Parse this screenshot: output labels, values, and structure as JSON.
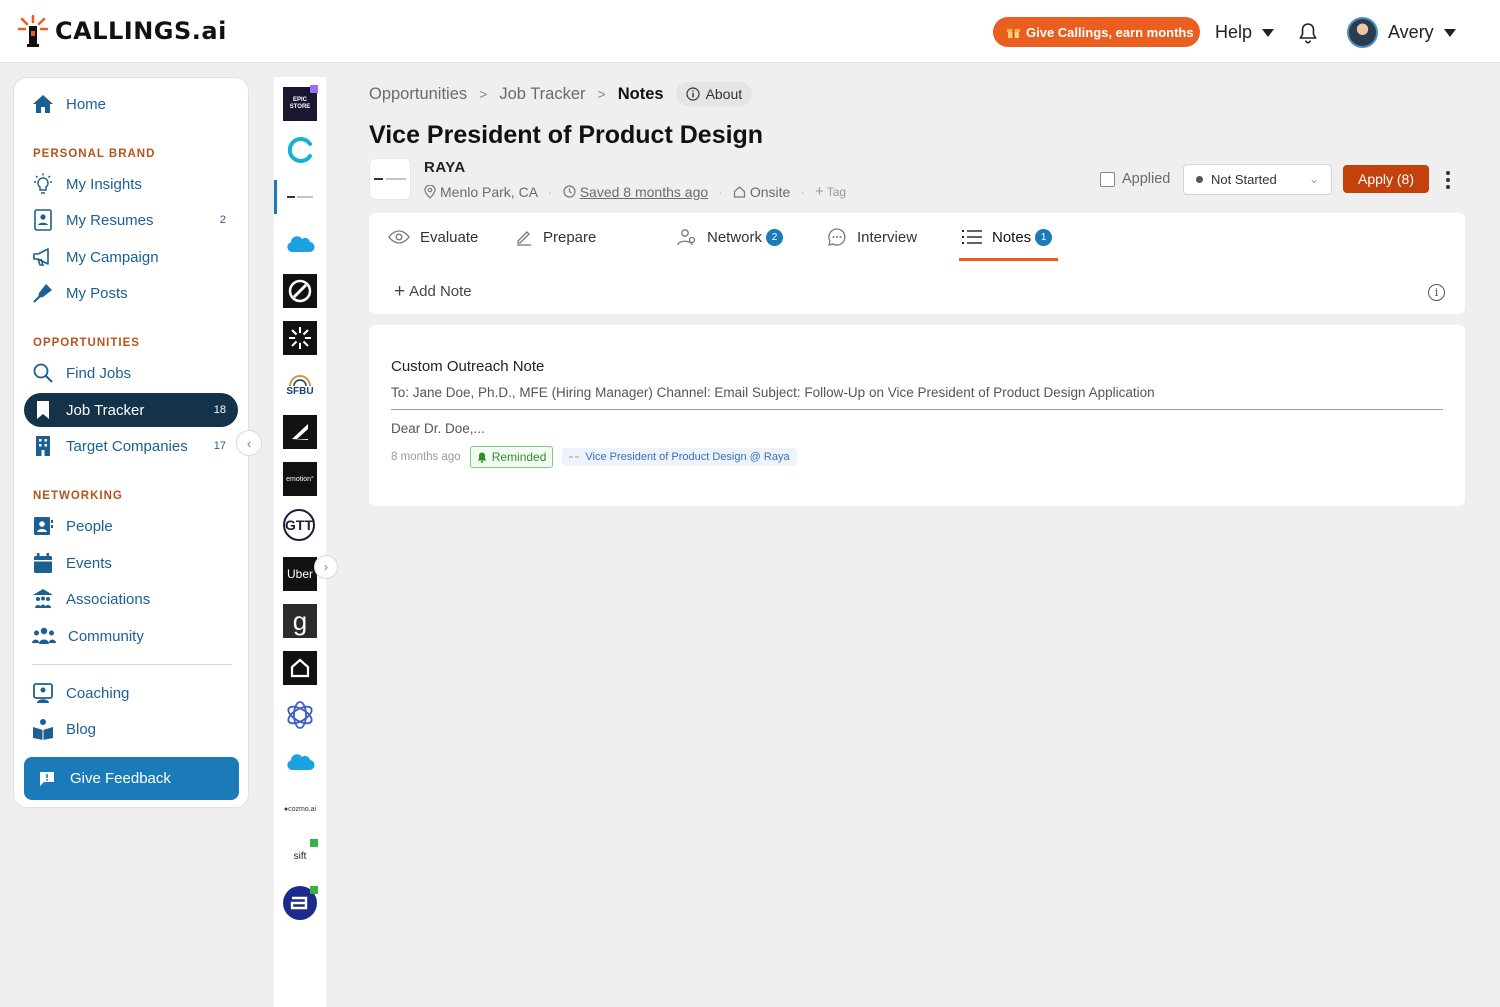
{
  "brand": {
    "name": "CALLINGS",
    "suffix": ".ai"
  },
  "topbar": {
    "promo_label": "Give Callings, earn months",
    "help_label": "Help",
    "user_name": "Avery"
  },
  "sidebar": {
    "home": "Home",
    "sections": {
      "personal_brand": "PERSONAL BRAND",
      "opportunities": "OPPORTUNITIES",
      "networking": "NETWORKING"
    },
    "items": {
      "my_insights": "My Insights",
      "my_resumes": "My Resumes",
      "my_resumes_count": "2",
      "my_campaign": "My Campaign",
      "my_posts": "My Posts",
      "find_jobs": "Find Jobs",
      "job_tracker": "Job Tracker",
      "job_tracker_count": "18",
      "target_companies": "Target Companies",
      "target_companies_count": "17",
      "people": "People",
      "events": "Events",
      "associations": "Associations",
      "community": "Community",
      "coaching": "Coaching",
      "blog": "Blog"
    },
    "feedback_label": "Give Feedback",
    "active_color": "#14324a",
    "accent_color": "#1a7bb8"
  },
  "rail": {
    "labels": {
      "epic": "EPIC STORE",
      "salesforce": "salesforce",
      "sfbu": "SFBU",
      "emotion": "emotion°",
      "gtt": "GTT",
      "uber": "Uber",
      "g": "g",
      "cozmo": "●cozmo.ai",
      "sift": "sift"
    }
  },
  "breadcrumb": {
    "items": [
      "Opportunities",
      "Job Tracker"
    ],
    "current": "Notes",
    "about_label": "About"
  },
  "job": {
    "title": "Vice President of Product Design",
    "company": "RAYA",
    "location": "Menlo Park, CA",
    "saved": "Saved 8 months ago",
    "workplace": "Onsite",
    "tag_label": "Tag",
    "applied_label": "Applied",
    "status": "Not Started",
    "apply_label": "Apply (8)"
  },
  "tabs": [
    {
      "label": "Evaluate",
      "icon": "eye-icon"
    },
    {
      "label": "Prepare",
      "icon": "pencil-icon"
    },
    {
      "label": "Network",
      "icon": "people-icon",
      "badge": "2"
    },
    {
      "label": "Interview",
      "icon": "chat-icon"
    },
    {
      "label": "Notes",
      "icon": "list-icon",
      "badge": "1"
    }
  ],
  "active_tab": "Notes",
  "add_note_label": "Add Note",
  "note": {
    "title": "Custom Outreach Note",
    "to_line": "To: Jane Doe, Ph.D., MFE (Hiring Manager) Channel: Email Subject: Follow-Up on Vice President of Product Design Application",
    "preview": "Dear Dr. Doe,...",
    "time": "8 months ago",
    "reminder": "Reminded",
    "job_tag": "Vice President of Product Design @ Raya"
  },
  "colors": {
    "promo": "#ea5f1f",
    "apply": "#c2410c",
    "tab_underline": "#ea5f1f",
    "badge": "#1a7bb8"
  }
}
